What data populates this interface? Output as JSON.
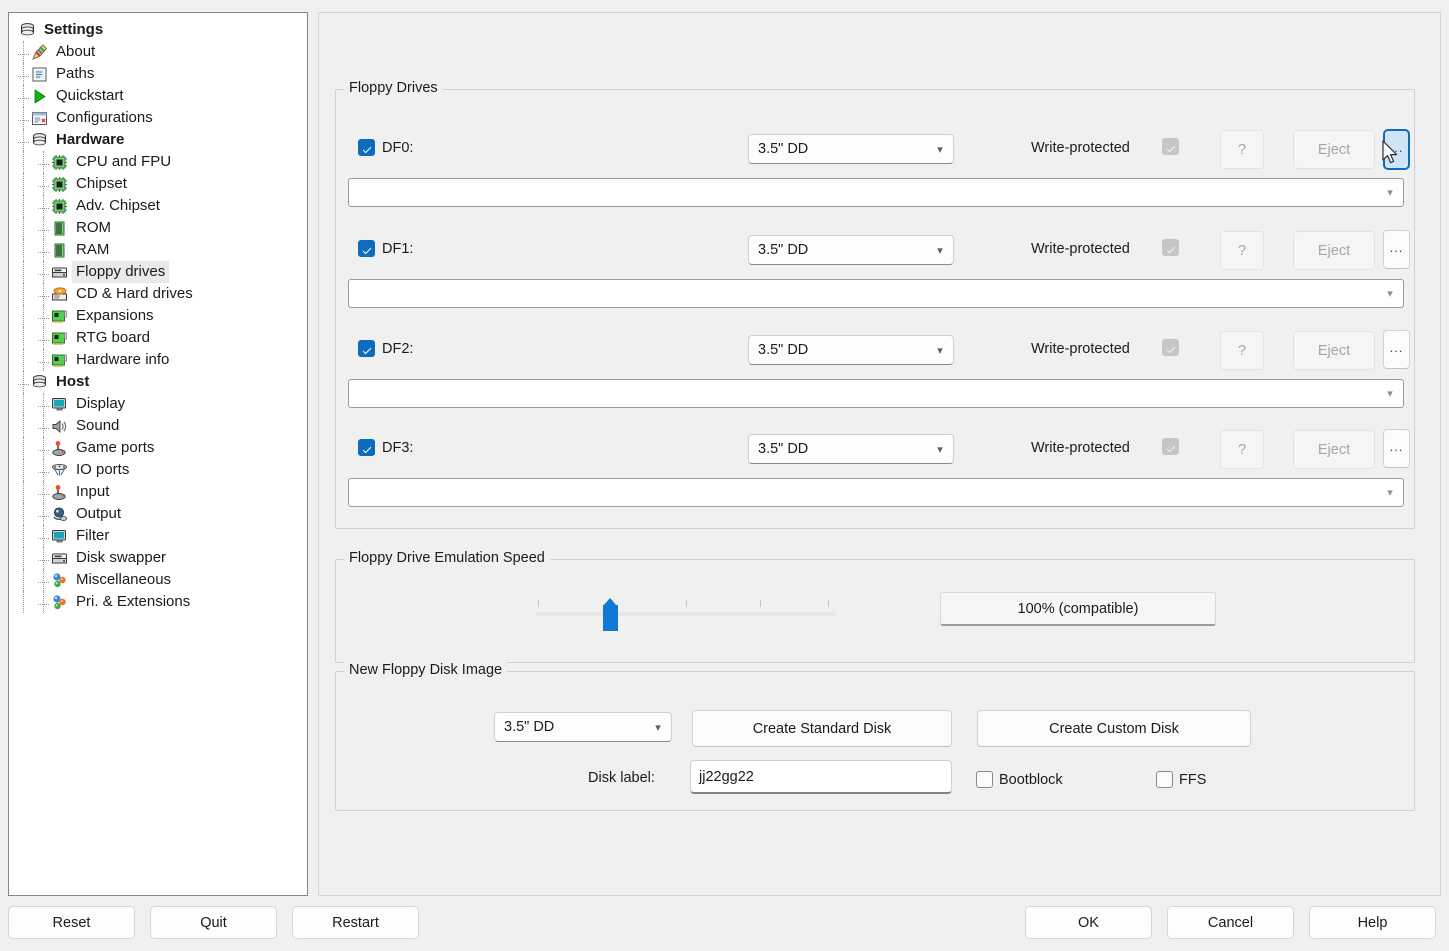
{
  "tree": {
    "root_label": "Settings",
    "items": [
      {
        "label": "About",
        "icon": "pencil-icon",
        "level": 1,
        "bold": false,
        "selected": false
      },
      {
        "label": "Paths",
        "icon": "paths-icon",
        "level": 1,
        "bold": false,
        "selected": false
      },
      {
        "label": "Quickstart",
        "icon": "play-icon",
        "level": 1,
        "bold": false,
        "selected": false
      },
      {
        "label": "Configurations",
        "icon": "configurations-icon",
        "level": 1,
        "bold": false,
        "selected": false
      },
      {
        "label": "Hardware",
        "icon": "stack-icon",
        "level": 1,
        "bold": true,
        "selected": false
      },
      {
        "label": "CPU and FPU",
        "icon": "chip-icon",
        "level": 2,
        "bold": false,
        "selected": false
      },
      {
        "label": "Chipset",
        "icon": "chip-icon",
        "level": 2,
        "bold": false,
        "selected": false
      },
      {
        "label": "Adv. Chipset",
        "icon": "chip-icon",
        "level": 2,
        "bold": false,
        "selected": false
      },
      {
        "label": "ROM",
        "icon": "memory-icon",
        "level": 2,
        "bold": false,
        "selected": false
      },
      {
        "label": "RAM",
        "icon": "memory-icon",
        "level": 2,
        "bold": false,
        "selected": false
      },
      {
        "label": "Floppy drives",
        "icon": "floppy-drive-icon",
        "level": 2,
        "bold": false,
        "selected": true
      },
      {
        "label": "CD & Hard drives",
        "icon": "cd-drive-icon",
        "level": 2,
        "bold": false,
        "selected": false
      },
      {
        "label": "Expansions",
        "icon": "card-icon",
        "level": 2,
        "bold": false,
        "selected": false
      },
      {
        "label": "RTG board",
        "icon": "card-icon",
        "level": 2,
        "bold": false,
        "selected": false
      },
      {
        "label": "Hardware info",
        "icon": "card-icon",
        "level": 2,
        "bold": false,
        "selected": false
      },
      {
        "label": "Host",
        "icon": "stack-icon",
        "level": 1,
        "bold": true,
        "selected": false
      },
      {
        "label": "Display",
        "icon": "monitor-icon",
        "level": 2,
        "bold": false,
        "selected": false
      },
      {
        "label": "Sound",
        "icon": "speaker-icon",
        "level": 2,
        "bold": false,
        "selected": false
      },
      {
        "label": "Game ports",
        "icon": "joystick-icon",
        "level": 2,
        "bold": false,
        "selected": false
      },
      {
        "label": "IO ports",
        "icon": "ioports-icon",
        "level": 2,
        "bold": false,
        "selected": false
      },
      {
        "label": "Input",
        "icon": "joystick-icon",
        "level": 2,
        "bold": false,
        "selected": false
      },
      {
        "label": "Output",
        "icon": "output-icon",
        "level": 2,
        "bold": false,
        "selected": false
      },
      {
        "label": "Filter",
        "icon": "monitor-icon",
        "level": 2,
        "bold": false,
        "selected": false
      },
      {
        "label": "Disk swapper",
        "icon": "floppy-drive-icon",
        "level": 2,
        "bold": false,
        "selected": false
      },
      {
        "label": "Miscellaneous",
        "icon": "spheres-icon",
        "level": 2,
        "bold": false,
        "selected": false
      },
      {
        "label": "Pri. & Extensions",
        "icon": "spheres-icon",
        "level": 2,
        "bold": false,
        "selected": false
      }
    ]
  },
  "floppy_drives": {
    "group_title": "Floppy Drives",
    "write_protected_label": "Write-protected",
    "help_label": "?",
    "eject_label": "Eject",
    "browse_label": "...",
    "drives": [
      {
        "name": "DF0:",
        "enabled": true,
        "type": "3.5\" DD",
        "path": "",
        "write_protected": true
      },
      {
        "name": "DF1:",
        "enabled": true,
        "type": "3.5\" DD",
        "path": "",
        "write_protected": true
      },
      {
        "name": "DF2:",
        "enabled": true,
        "type": "3.5\" DD",
        "path": "",
        "write_protected": true
      },
      {
        "name": "DF3:",
        "enabled": true,
        "type": "3.5\" DD",
        "path": "",
        "write_protected": true
      }
    ]
  },
  "emulation_speed": {
    "group_title": "Floppy Drive Emulation Speed",
    "value_label": "100% (compatible)",
    "slider_position_percent": 26,
    "tick_count": 5
  },
  "new_disk_image": {
    "group_title": "New Floppy Disk Image",
    "type_value": "3.5\" DD",
    "create_standard_label": "Create Standard Disk",
    "create_custom_label": "Create Custom Disk",
    "disk_label_caption": "Disk label:",
    "disk_label_value": "jj22gg22",
    "bootblock_label": "Bootblock",
    "bootblock_checked": false,
    "ffs_label": "FFS",
    "ffs_checked": false
  },
  "bottom_bar": {
    "reset_label": "Reset",
    "quit_label": "Quit",
    "restart_label": "Restart",
    "ok_label": "OK",
    "cancel_label": "Cancel",
    "help_label": "Help"
  },
  "colors": {
    "accent": "#0f6cbd",
    "slider_blue": "#0f7ad6",
    "hover_fill": "#cfe4f7",
    "window_bg": "#f0f0f0"
  }
}
